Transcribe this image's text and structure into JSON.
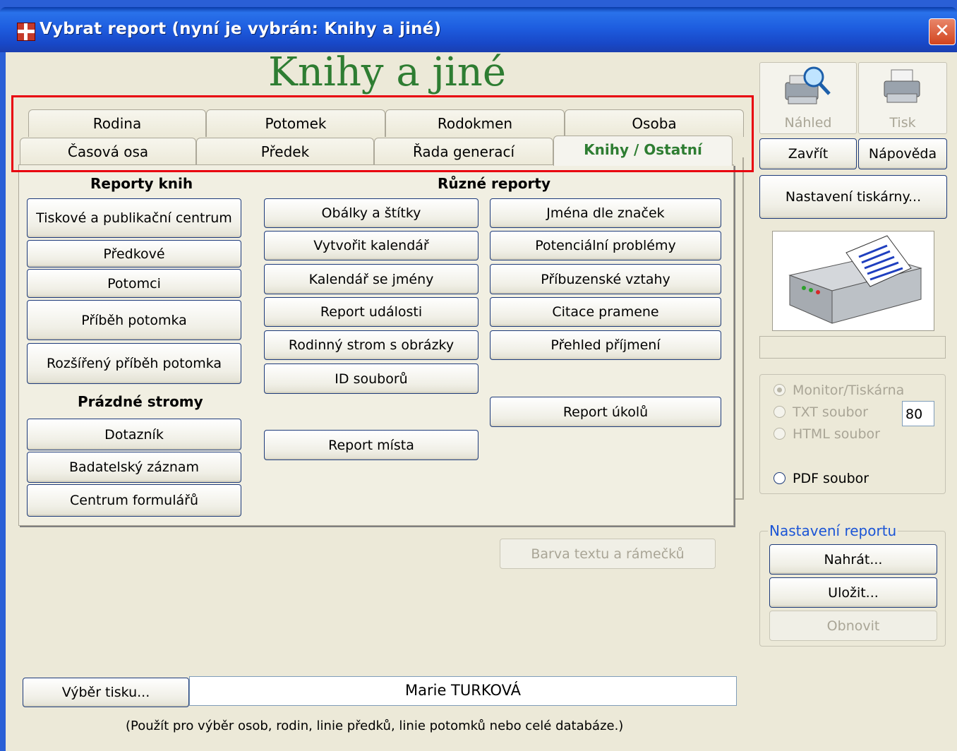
{
  "window": {
    "title": "Vybrat report (nyní je vybrán: Knihy a jiné)"
  },
  "heading": "Knihy a jiné",
  "tabs": {
    "row1": [
      "Rodina",
      "Potomek",
      "Rodokmen",
      "Osoba"
    ],
    "row2": [
      "Časová osa",
      "Předek",
      "Řada generací",
      "Knihy / Ostatní"
    ],
    "active": "Knihy / Ostatní"
  },
  "sections": {
    "book_reports": "Reporty knih",
    "empty_trees": "Prázdné stromy",
    "misc_reports": "Různé reporty"
  },
  "buttons": {
    "book_reports": [
      "Tiskové a publikační centrum",
      "Předkové",
      "Potomci",
      "Příběh potomka",
      "Rozšířený příběh potomka"
    ],
    "empty_trees": [
      "Dotazník",
      "Badatelský záznam",
      "Centrum formulářů"
    ],
    "misc_col1": [
      "Obálky a štítky",
      "Vytvořit kalendář",
      "Kalendář se jmény",
      "Report události",
      "Rodinný strom s obrázky",
      "ID souborů",
      "Report místa"
    ],
    "misc_col2": [
      "Jména dle značek",
      "Potenciální problémy",
      "Příbuzenské vztahy",
      "Citace pramene",
      "Přehled příjmení",
      "Report úkolů"
    ],
    "text_color": "Barva textu a rámečků",
    "print_selection": "Výběr tisku..."
  },
  "right_panel": {
    "preview": "Náhled",
    "print": "Tisk",
    "close": "Zavřít",
    "help": "Nápověda",
    "printer_setup": "Nastavení tiskárny...",
    "output": {
      "options": [
        "Monitor/Tiskárna",
        "TXT soubor",
        "HTML soubor",
        "PDF soubor"
      ],
      "selected": "Monitor/Tiskárna",
      "width_value": "80"
    },
    "report_settings": {
      "title": "Nastavení reportu",
      "load": "Nahrát...",
      "save": "Uložit...",
      "reset": "Obnovit"
    }
  },
  "selection": {
    "person": "Marie TURKOVÁ",
    "note": "(Použít pro výběr osob, rodin, linie předků, linie potomků nebo celé databáze.)"
  },
  "colors": {
    "heading": "#2e7d32",
    "titlebar": "#1e5ee0",
    "highlight": "#e8000f"
  }
}
